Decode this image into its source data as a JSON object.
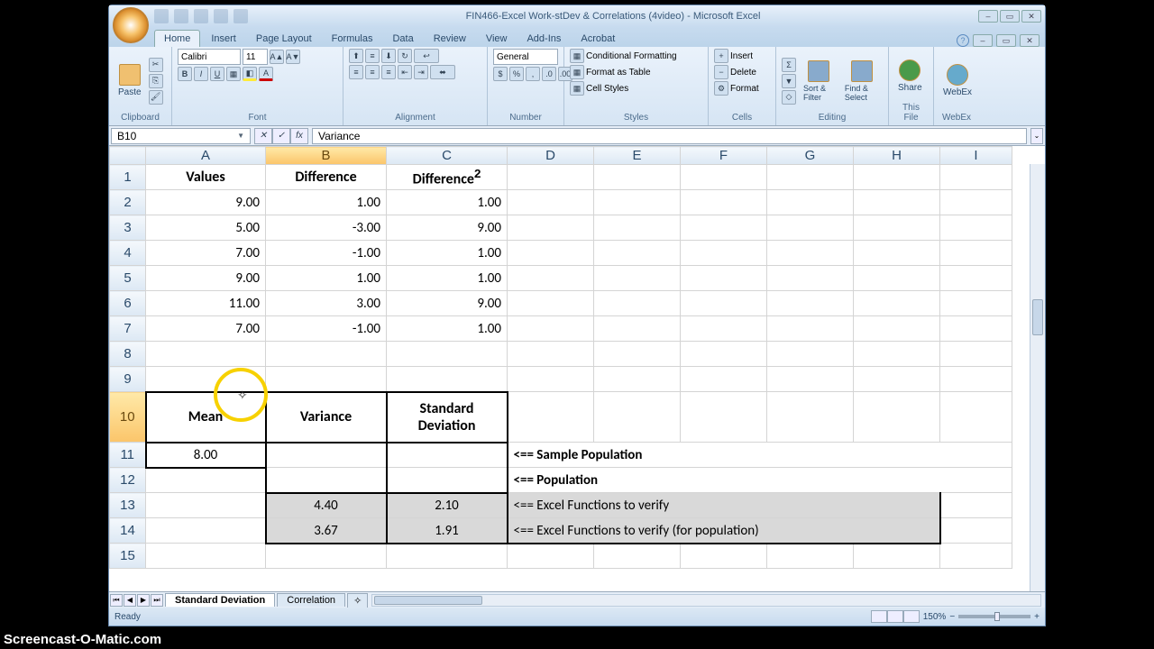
{
  "title": "FIN466-Excel Work-stDev & Correlations (4video) - Microsoft Excel",
  "tabs": [
    "Home",
    "Insert",
    "Page Layout",
    "Formulas",
    "Data",
    "Review",
    "View",
    "Add-Ins",
    "Acrobat"
  ],
  "activeTab": "Home",
  "ribbon": {
    "clipboard": {
      "label": "Clipboard",
      "paste": "Paste"
    },
    "font": {
      "label": "Font",
      "name": "Calibri",
      "size": "11"
    },
    "alignment": {
      "label": "Alignment"
    },
    "number": {
      "label": "Number",
      "format": "General"
    },
    "styles": {
      "label": "Styles",
      "cond": "Conditional Formatting",
      "table": "Format as Table",
      "cell": "Cell Styles"
    },
    "cells": {
      "label": "Cells",
      "insert": "Insert",
      "delete": "Delete",
      "format": "Format"
    },
    "editing": {
      "label": "Editing",
      "sort": "Sort & Filter",
      "find": "Find & Select"
    },
    "share": {
      "label": "This File",
      "share": "Share"
    },
    "webex": {
      "label": "WebEx",
      "btn": "WebEx"
    }
  },
  "namebox": "B10",
  "formula": "Variance",
  "columns": [
    "A",
    "B",
    "C",
    "D",
    "E",
    "F",
    "G",
    "H",
    "I"
  ],
  "selectedCol": "B",
  "selectedRow": "10",
  "headers": {
    "A": "Values",
    "B": "Difference",
    "C_html": "Difference<sup>2</sup>"
  },
  "data": [
    {
      "r": "2",
      "A": "9.00",
      "B": "1.00",
      "C": "1.00"
    },
    {
      "r": "3",
      "A": "5.00",
      "B": "-3.00",
      "C": "9.00"
    },
    {
      "r": "4",
      "A": "7.00",
      "B": "-1.00",
      "C": "1.00"
    },
    {
      "r": "5",
      "A": "9.00",
      "B": "1.00",
      "C": "1.00"
    },
    {
      "r": "6",
      "A": "11.00",
      "B": "3.00",
      "C": "9.00"
    },
    {
      "r": "7",
      "A": "7.00",
      "B": "-1.00",
      "C": "1.00"
    }
  ],
  "stats_head": {
    "A": "Mean",
    "B": "Variance",
    "C": "Standard Deviation"
  },
  "r11": {
    "A": "8.00",
    "B": "",
    "C": "",
    "D": "<== Sample Population"
  },
  "r12": {
    "A": "",
    "B": "",
    "C": "",
    "D": "<== Population"
  },
  "r13": {
    "A": "",
    "B": "4.40",
    "C": "2.10",
    "D": "<== Excel Functions to verify"
  },
  "r14": {
    "A": "",
    "B": "3.67",
    "C": "1.91",
    "D": "<== Excel Functions to verify (for population)"
  },
  "sheets": [
    "Standard Deviation",
    "Correlation"
  ],
  "activeSheet": "Standard Deviation",
  "status": "Ready",
  "zoom": "150%",
  "watermark": "Screencast-O-Matic.com"
}
